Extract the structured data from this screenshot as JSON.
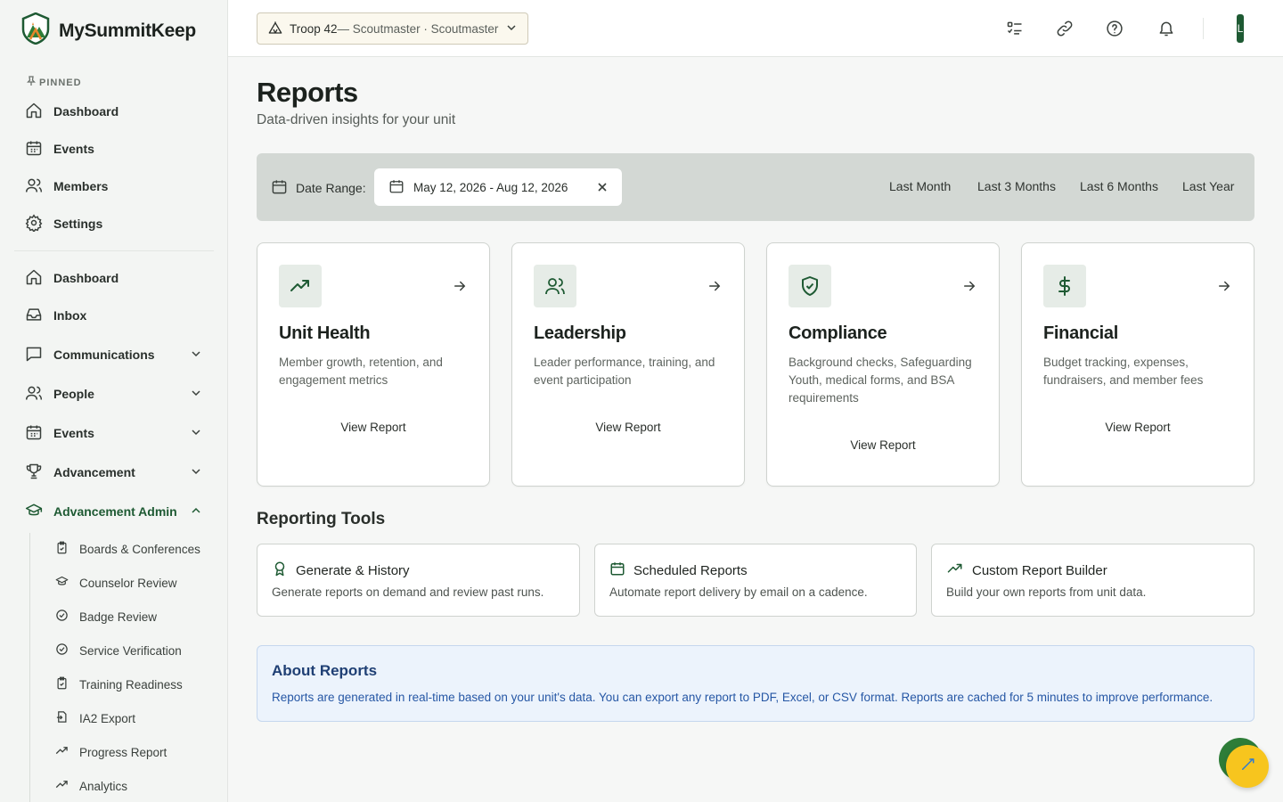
{
  "app": {
    "name": "MySummitKeep"
  },
  "sidebar": {
    "pinned_label": "PINNED",
    "pinned": [
      {
        "label": "Dashboard",
        "icon": "home-icon"
      },
      {
        "label": "Events",
        "icon": "calendar-icon"
      },
      {
        "label": "Members",
        "icon": "users-icon"
      },
      {
        "label": "Settings",
        "icon": "gear-icon"
      }
    ],
    "items": [
      {
        "label": "Dashboard",
        "icon": "home-icon"
      },
      {
        "label": "Inbox",
        "icon": "inbox-icon"
      },
      {
        "label": "Communications",
        "icon": "message-icon",
        "expandable": true
      },
      {
        "label": "People",
        "icon": "users-icon",
        "expandable": true
      },
      {
        "label": "Events",
        "icon": "calendar-icon",
        "expandable": true
      },
      {
        "label": "Advancement",
        "icon": "trophy-icon",
        "expandable": true
      },
      {
        "label": "Advancement Admin",
        "icon": "graduation-cap-icon",
        "expandable": true,
        "expanded": true
      }
    ],
    "subitems": [
      {
        "label": "Boards & Conferences",
        "icon": "clipboard-check-icon"
      },
      {
        "label": "Counselor Review",
        "icon": "graduation-cap-icon"
      },
      {
        "label": "Badge Review",
        "icon": "check-circle-icon"
      },
      {
        "label": "Service Verification",
        "icon": "check-circle-icon"
      },
      {
        "label": "Training Readiness",
        "icon": "clipboard-check-icon"
      },
      {
        "label": "IA2 Export",
        "icon": "file-export-icon"
      },
      {
        "label": "Progress Report",
        "icon": "trending-up-icon"
      },
      {
        "label": "Analytics",
        "icon": "trending-up-icon"
      }
    ]
  },
  "header": {
    "troop": "Troop 42",
    "role": " — Scoutmaster · Scoutmaster",
    "avatar_letter": "L"
  },
  "main": {
    "title": "Reports",
    "subtitle": "Data-driven insights for your unit",
    "filter": {
      "label": "Date Range:",
      "value": "May 12, 2026 - Aug 12, 2026",
      "presets": [
        "Last Month",
        "Last 3 Months",
        "Last 6 Months",
        "Last Year"
      ]
    },
    "cards": [
      {
        "title": "Unit Health",
        "desc": "Member growth, retention, and engagement metrics",
        "link": "View Report",
        "icon": "trending-up-icon"
      },
      {
        "title": "Leadership",
        "desc": "Leader performance, training, and event participation",
        "link": "View Report",
        "icon": "users-icon"
      },
      {
        "title": "Compliance",
        "desc": "Background checks, Safeguarding Youth, medical forms, and BSA requirements",
        "link": "View Report",
        "icon": "shield-check-icon"
      },
      {
        "title": "Financial",
        "desc": "Budget tracking, expenses, fundraisers, and member fees",
        "link": "View Report",
        "icon": "dollar-icon"
      }
    ],
    "tools_title": "Reporting Tools",
    "tools": [
      {
        "title": "Generate & History",
        "desc": "Generate reports on demand and review past runs.",
        "icon": "award-icon"
      },
      {
        "title": "Scheduled Reports",
        "desc": "Automate report delivery by email on a cadence.",
        "icon": "calendar-icon"
      },
      {
        "title": "Custom Report Builder",
        "desc": "Build your own reports from unit data.",
        "icon": "trending-up-icon"
      }
    ],
    "about": {
      "title": "About Reports",
      "text": "Reports are generated in real-time based on your unit's data. You can export any report to PDF, Excel, or CSV format. Reports are cached for 5 minutes to improve performance."
    }
  },
  "colors": {
    "brand_green": "#1e5a33",
    "filter_bg": "#d3d8d4",
    "about_bg": "#ecf3fc",
    "about_title": "#1f3f74",
    "fab": "#f7c51e"
  }
}
